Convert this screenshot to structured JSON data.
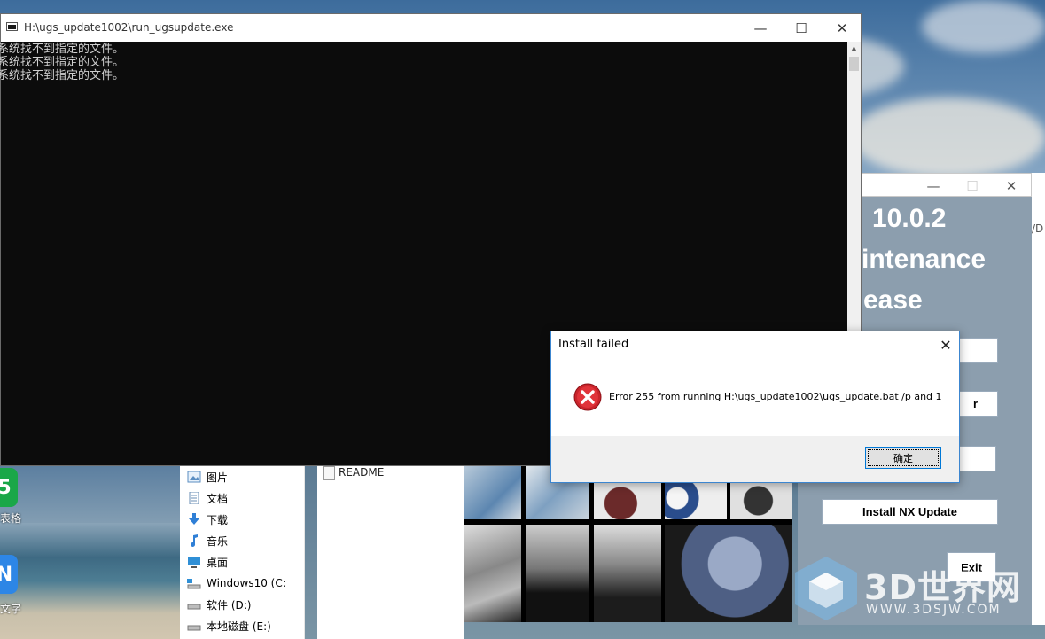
{
  "desktop": {
    "icons": [
      {
        "glyph": "5",
        "label": "表格"
      },
      {
        "glyph": "N",
        "label": "文字"
      }
    ]
  },
  "explorer": {
    "nav_items": [
      {
        "label": "图片",
        "icon": "pictures-icon"
      },
      {
        "label": "文档",
        "icon": "documents-icon"
      },
      {
        "label": "下载",
        "icon": "download-icon"
      },
      {
        "label": "音乐",
        "icon": "music-icon"
      },
      {
        "label": "桌面",
        "icon": "desktop-icon"
      },
      {
        "label": "Windows10 (C:",
        "icon": "drive-icon"
      },
      {
        "label": "软件 (D:)",
        "icon": "drive-icon"
      },
      {
        "label": "本地磁盘 (E:)",
        "icon": "drive-icon"
      }
    ],
    "files": [
      {
        "name": "README"
      }
    ]
  },
  "console": {
    "title": "H:\\ugs_update1002\\run_ugsupdate.exe",
    "output_lines": [
      "系统找不到指定的文件。",
      "系统找不到指定的文件。",
      "系统找不到指定的文件。"
    ],
    "titlebar_buttons": {
      "minimize": "—",
      "maximize": "☐",
      "close": "✕"
    }
  },
  "launcher": {
    "title_lines": [
      "10.0.2",
      "intenance",
      "ease"
    ],
    "side_text": "/D",
    "buttons": {
      "install_nx_update": "Install NX Update",
      "partial_r": "r",
      "exit": "Exit"
    },
    "titlebar_buttons": {
      "minimize": "—",
      "maximize": "☐",
      "close": "✕"
    }
  },
  "dialog": {
    "title": "Install failed",
    "close": "✕",
    "message": "Error 255 from running H:\\ugs_update1002\\ugs_update.bat /p and 1",
    "ok_label": "确定",
    "icon": "error-icon",
    "accent_color": "#d7282f"
  },
  "watermark": {
    "text": "3D世界网",
    "url": "WWW.3DSJW.COM"
  }
}
